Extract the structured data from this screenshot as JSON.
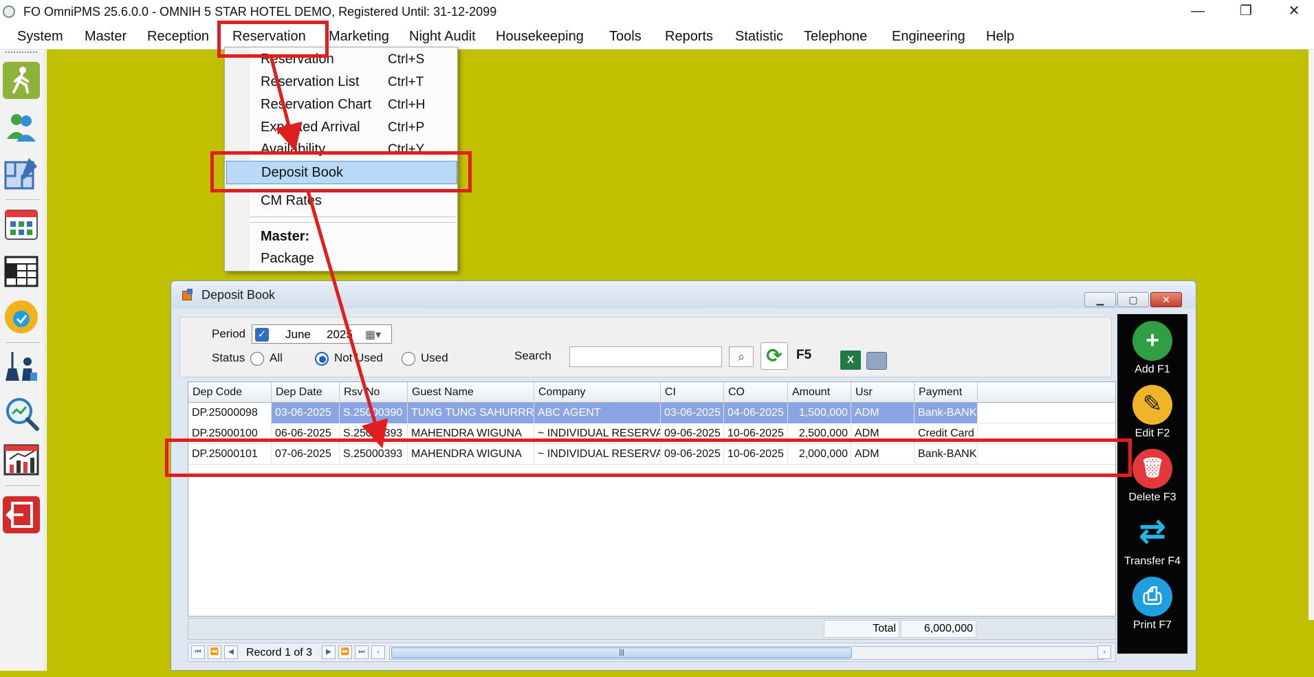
{
  "window": {
    "title": "FO OmniPMS 25.6.0.0 - OMNIH 5 STAR HOTEL DEMO, Registered Until: 31-12-2099",
    "min_glyph": "—",
    "max_glyph": "❐",
    "close_glyph": "✕"
  },
  "menubar": {
    "items": [
      "System",
      "Master",
      "Reception",
      "Reservation",
      "Marketing",
      "Night Audit",
      "Housekeeping",
      "Tools",
      "Reports",
      "Statistic",
      "Telephone",
      "Engineering",
      "Help"
    ]
  },
  "sidebar": {
    "icons": [
      "walk-in-icon",
      "guests-icon",
      "room-plan-icon",
      "calendar-grid-icon",
      "calendar-2023-icon",
      "availability-badge-icon",
      "housekeeping-icon",
      "search-analytics-icon",
      "report-chart-icon",
      "exit-icon"
    ]
  },
  "reservation_menu": {
    "items": [
      {
        "label": "Reservation",
        "shortcut": "Ctrl+S"
      },
      {
        "label": "Reservation List",
        "shortcut": "Ctrl+T"
      },
      {
        "label": "Reservation Chart",
        "shortcut": "Ctrl+H"
      },
      {
        "label": "Expected Arrival",
        "shortcut": "Ctrl+P"
      },
      {
        "label": "Availability",
        "shortcut": "Ctrl+Y"
      },
      {
        "label": "Deposit Book",
        "shortcut": ""
      },
      {
        "label": "CM Rates",
        "shortcut": ""
      }
    ],
    "section_header": "Master:",
    "section_items": [
      "Package"
    ],
    "highlighted": "Deposit Book"
  },
  "deposit_book": {
    "title": "Deposit Book",
    "period_label": "Period",
    "period_checked": true,
    "period_month": "June",
    "period_year": "2025",
    "status_label": "Status",
    "status_options": [
      "All",
      "Not Used",
      "Used"
    ],
    "status_selected": "Not Used",
    "search_label": "Search",
    "search_value": "",
    "refresh_key": "F5",
    "columns": [
      "Dep Code",
      "Dep Date",
      "Rsv No",
      "Guest Name",
      "Company",
      "CI",
      "CO",
      "Amount",
      "Usr",
      "Payment"
    ],
    "rows": [
      [
        "DP.25000098",
        "03-06-2025",
        "S.25000390",
        "TUNG TUNG SAHURRR TRA...",
        "ABC AGENT",
        "03-06-2025",
        "04-06-2025",
        "1,500,000",
        "ADM",
        "Bank-BANK"
      ],
      [
        "DP.25000100",
        "06-06-2025",
        "S.25000393",
        "MAHENDRA WIGUNA",
        "~ INDIVIDUAL RESERVATI...",
        "09-06-2025",
        "10-06-2025",
        "2,500,000",
        "ADM",
        "Credit Card"
      ],
      [
        "DP.25000101",
        "07-06-2025",
        "S.25000393",
        "MAHENDRA WIGUNA",
        "~ INDIVIDUAL RESERVATI...",
        "09-06-2025",
        "10-06-2025",
        "2,000,000",
        "ADM",
        "Bank-BANK"
      ]
    ],
    "total_label": "Total",
    "total_value": "6,000,000",
    "record_text": "Record 1 of 3",
    "actions": [
      {
        "label": "Add F1",
        "color": "#2ea043",
        "glyph": "+"
      },
      {
        "label": "Edit F2",
        "color": "#f0b429",
        "glyph": "✎"
      },
      {
        "label": "Delete F3",
        "color": "#e5383b",
        "glyph": "🗑"
      },
      {
        "label": "Transfer F4",
        "color": "#1fb6e8",
        "glyph": "⇄"
      },
      {
        "label": "Print F7",
        "color": "#1e9fe0",
        "glyph": "⎙"
      }
    ]
  },
  "colors": {
    "desktop": "#c0c000",
    "annotation": "#e11d1d",
    "selection": "#8aa5e4"
  }
}
